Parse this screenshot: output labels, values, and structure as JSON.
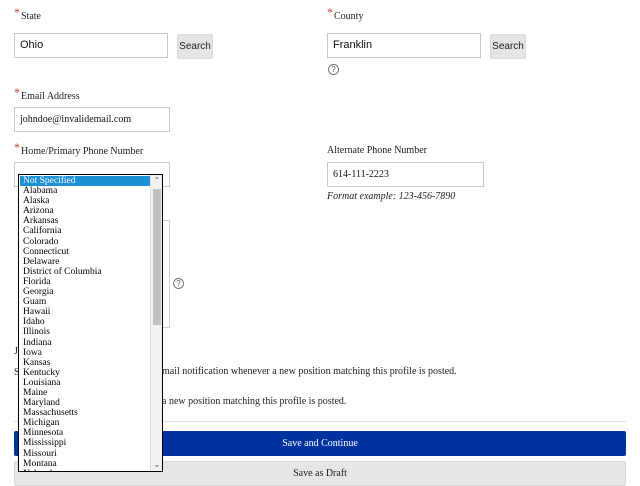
{
  "state": {
    "label": "State",
    "required_mark": "*",
    "value": "Ohio",
    "search_label": "Search"
  },
  "county": {
    "label": "County",
    "required_mark": "*",
    "value": "Franklin",
    "search_label": "Search",
    "help": "?"
  },
  "email": {
    "label": "Email Address",
    "required_mark": "*",
    "value": "johndoe@invalidemail.com"
  },
  "home_phone": {
    "label": "Home/Primary Phone Number",
    "required_mark": "*"
  },
  "alternate_phone": {
    "label": "Alternate Phone Number",
    "value": "614-111-2223",
    "format_hint": "Format example:  123-456-7890"
  },
  "partial": {
    "help": "?",
    "notify_text": "mail notification whenever a new position matching this profile is posted.",
    "notify_text_2": "a new position matching this profile is posted.",
    "j_char": "J",
    "s_char": "S"
  },
  "dropdown": {
    "selected": "Not Specified",
    "options": [
      "Not Specified",
      "Alabama",
      "Alaska",
      "Arizona",
      "Arkansas",
      "California",
      "Colorado",
      "Connecticut",
      "Delaware",
      "District of Columbia",
      "Florida",
      "Georgia",
      "Guam",
      "Hawaii",
      "Idaho",
      "Illinois",
      "Indiana",
      "Iowa",
      "Kansas",
      "Kentucky",
      "Louisiana",
      "Maine",
      "Maryland",
      "Massachusetts",
      "Michigan",
      "Minnesota",
      "Mississippi",
      "Missouri",
      "Montana",
      "Nebraska"
    ]
  },
  "actions": {
    "save_continue": "Save and Continue",
    "save_draft": "Save as Draft"
  },
  "colors": {
    "primary_button": "#0033a0",
    "required": "#c0392b",
    "selected_option": "#1e90d8"
  },
  "icons": {
    "help": "help-icon",
    "scroll_up": "chevron-up-icon",
    "scroll_down": "chevron-down-icon"
  }
}
